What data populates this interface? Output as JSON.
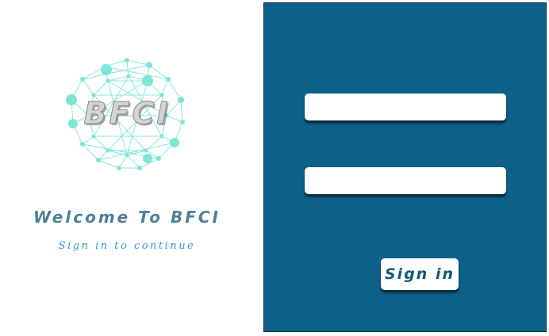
{
  "brand": {
    "logo_text": "BFCI",
    "welcome_title": "Welcome To BFCI",
    "subtitle": "Sign in to continue"
  },
  "login": {
    "username_value": "",
    "password_value": "",
    "signin_label": "Sign in"
  },
  "colors": {
    "panel_background": "#0d6189",
    "logo_network": "#7de6d6",
    "welcome_text": "#4e7f98",
    "subtitle_text": "#2e9ccc",
    "button_text": "#0f5a80"
  },
  "icons": {
    "logo": "network-sphere-icon"
  }
}
